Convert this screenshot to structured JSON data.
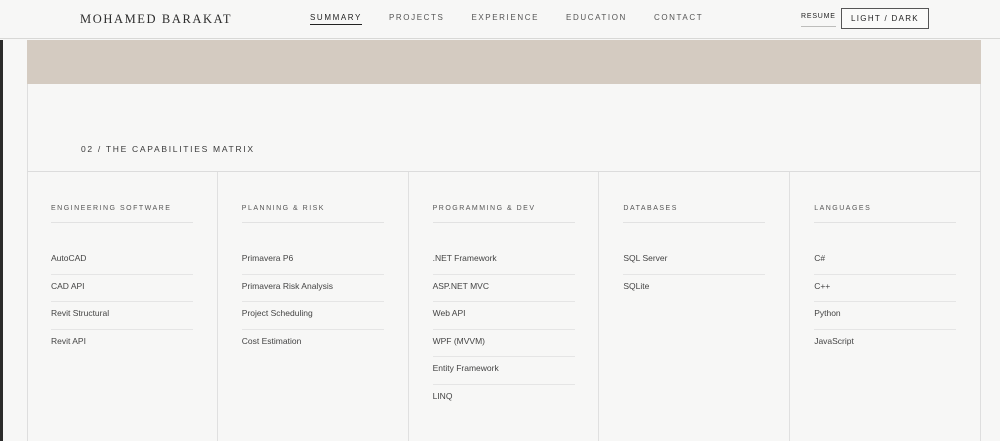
{
  "header": {
    "brand": "MOHAMED BARAKAT",
    "nav": [
      "SUMMARY",
      "PROJECTS",
      "EXPERIENCE",
      "EDUCATION",
      "CONTACT"
    ],
    "active_nav": "SUMMARY",
    "resume_label": "RESUME",
    "theme_label": "LIGHT / DARK"
  },
  "section": {
    "title": "02 / THE CAPABILITIES MATRIX"
  },
  "matrix": [
    {
      "heading": "ENGINEERING SOFTWARE",
      "items": [
        "AutoCAD",
        "CAD API",
        "Revit Structural",
        "Revit API"
      ]
    },
    {
      "heading": "PLANNING & RISK",
      "items": [
        "Primavera P6",
        "Primavera Risk Analysis",
        "Project Scheduling",
        "Cost Estimation"
      ]
    },
    {
      "heading": "PROGRAMMING & DEV",
      "items": [
        ".NET Framework",
        "ASP.NET MVC",
        "Web API",
        "WPF (MVVM)",
        "Entity Framework",
        "LINQ"
      ]
    },
    {
      "heading": "DATABASES",
      "items": [
        "SQL Server",
        "SQLite"
      ]
    },
    {
      "heading": "LANGUAGES",
      "items": [
        "C#",
        "C++",
        "Python",
        "JavaScript"
      ]
    }
  ],
  "colors": {
    "band": "#d4cbc1",
    "background": "#f7f7f6",
    "text": "#333333"
  }
}
